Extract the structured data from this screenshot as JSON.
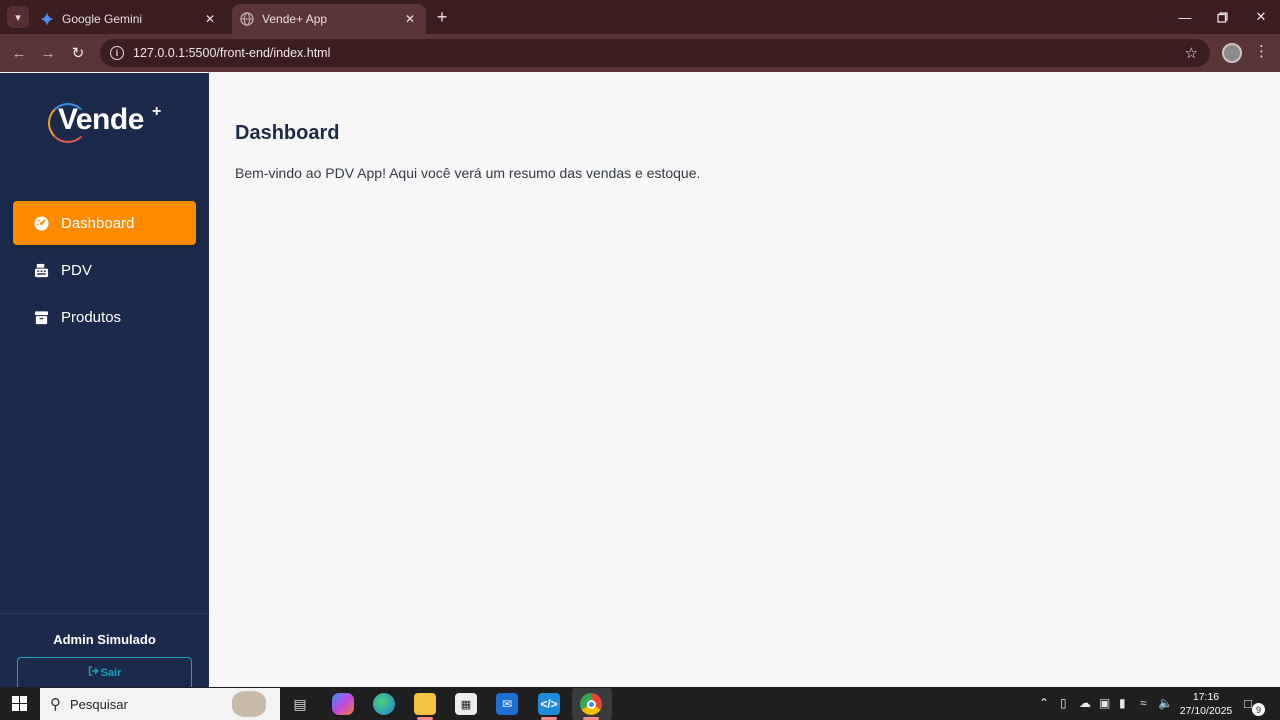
{
  "browser": {
    "tabs": [
      {
        "title": "Google Gemini",
        "active": false
      },
      {
        "title": "Vende+ App",
        "active": true
      }
    ],
    "url": "127.0.0.1:5500/front-end/index.html"
  },
  "sidebar": {
    "logo_text": "Vende",
    "logo_plus": "+",
    "items": [
      {
        "label": "Dashboard",
        "icon": "dashboard-gauge-icon",
        "active": true
      },
      {
        "label": "PDV",
        "icon": "cash-register-icon",
        "active": false
      },
      {
        "label": "Produtos",
        "icon": "box-icon",
        "active": false
      }
    ],
    "user_name": "Admin Simulado",
    "logout_label": "Sair"
  },
  "main": {
    "title": "Dashboard",
    "welcome": "Bem-vindo ao PDV App! Aqui você verá um resumo das vendas e estoque."
  },
  "taskbar": {
    "search_placeholder": "Pesquisar",
    "time": "17:16",
    "date": "27/10/2025",
    "notifications": "9"
  },
  "colors": {
    "sidebar_bg": "#1b2a4a",
    "accent": "#ff8c00",
    "logout": "#17a2b8"
  }
}
